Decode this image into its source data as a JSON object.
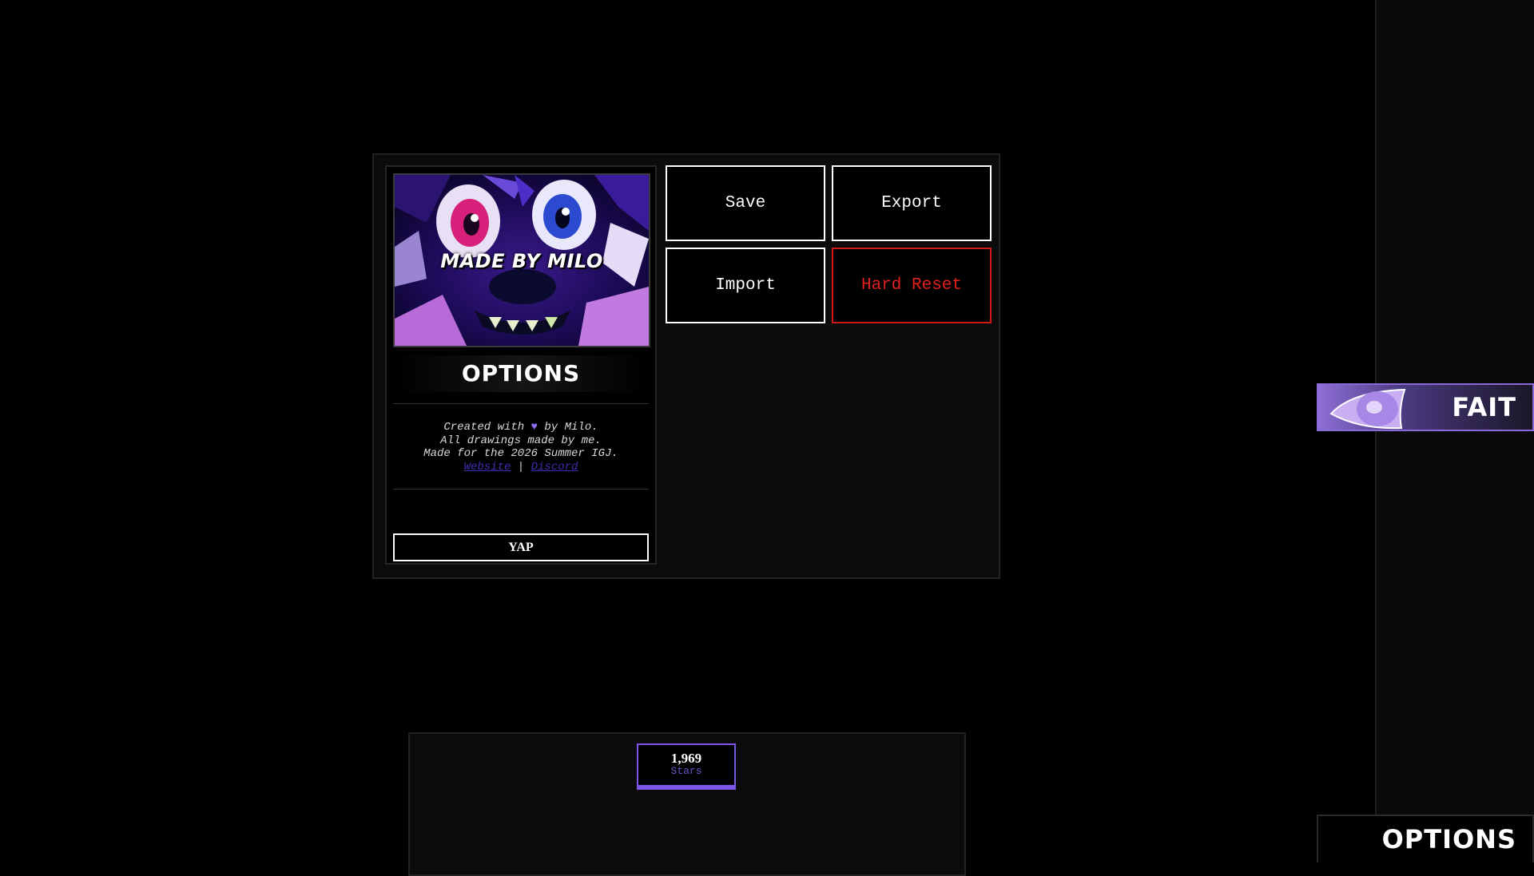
{
  "info_card": {
    "art_caption": "MADE BY MILO",
    "title": "OPTIONS",
    "credits_line1_pre": "Created with",
    "credits_line1_post": "by Milo.",
    "credits_line2": "All drawings made by me.",
    "credits_line3": "Made for the 2026 Summer IGJ.",
    "website_link": "Website",
    "link_separator": "|",
    "discord_link": "Discord",
    "yap_button": "YAP"
  },
  "buttons": {
    "save": "Save",
    "export": "Export",
    "import": "Import",
    "hard_reset": "Hard Reset"
  },
  "stats": {
    "stars_value": "1,969",
    "stars_label": "Stars"
  },
  "side_tabs": {
    "fait": "FAIT",
    "options": "OPTIONS"
  },
  "colors": {
    "accent": "#7c56e6",
    "danger": "#d01919",
    "heart": "#8f6bf0"
  }
}
